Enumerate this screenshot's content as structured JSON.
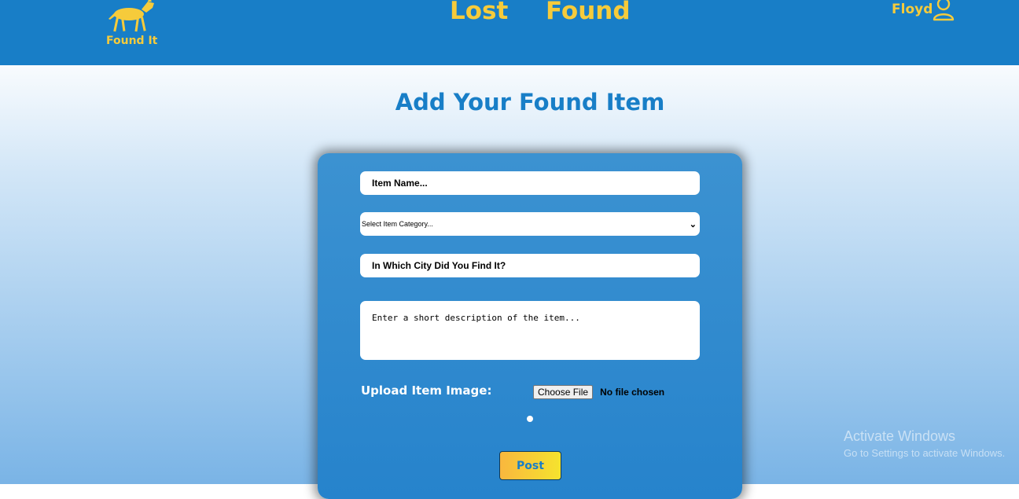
{
  "header": {
    "logo_text": "Found It",
    "nav": {
      "lost_label": "Lost",
      "found_label": "Found"
    },
    "user_name": "Floyd"
  },
  "page": {
    "title": "Add Your Found Item"
  },
  "form": {
    "item_name_placeholder": "Item Name...",
    "category_selected": "Select Item Category...",
    "city_placeholder": "In Which City Did You Find It?",
    "description_placeholder": "Enter a short description of the item...",
    "upload_label": "Upload Item Image:",
    "file_button_label": "Choose File",
    "file_status": "No file chosen",
    "post_label": "Post"
  },
  "watermark": {
    "line1": "Activate Windows",
    "line2": "Go to Settings to activate Windows."
  },
  "icons": {
    "logo": "dog-icon",
    "user": "user-icon",
    "select": "chevron-down-icon"
  },
  "colors": {
    "header": "#187ec7",
    "accent_yellow": "#f6cb3b",
    "card": "#2f8acf",
    "title": "#187ec7"
  }
}
